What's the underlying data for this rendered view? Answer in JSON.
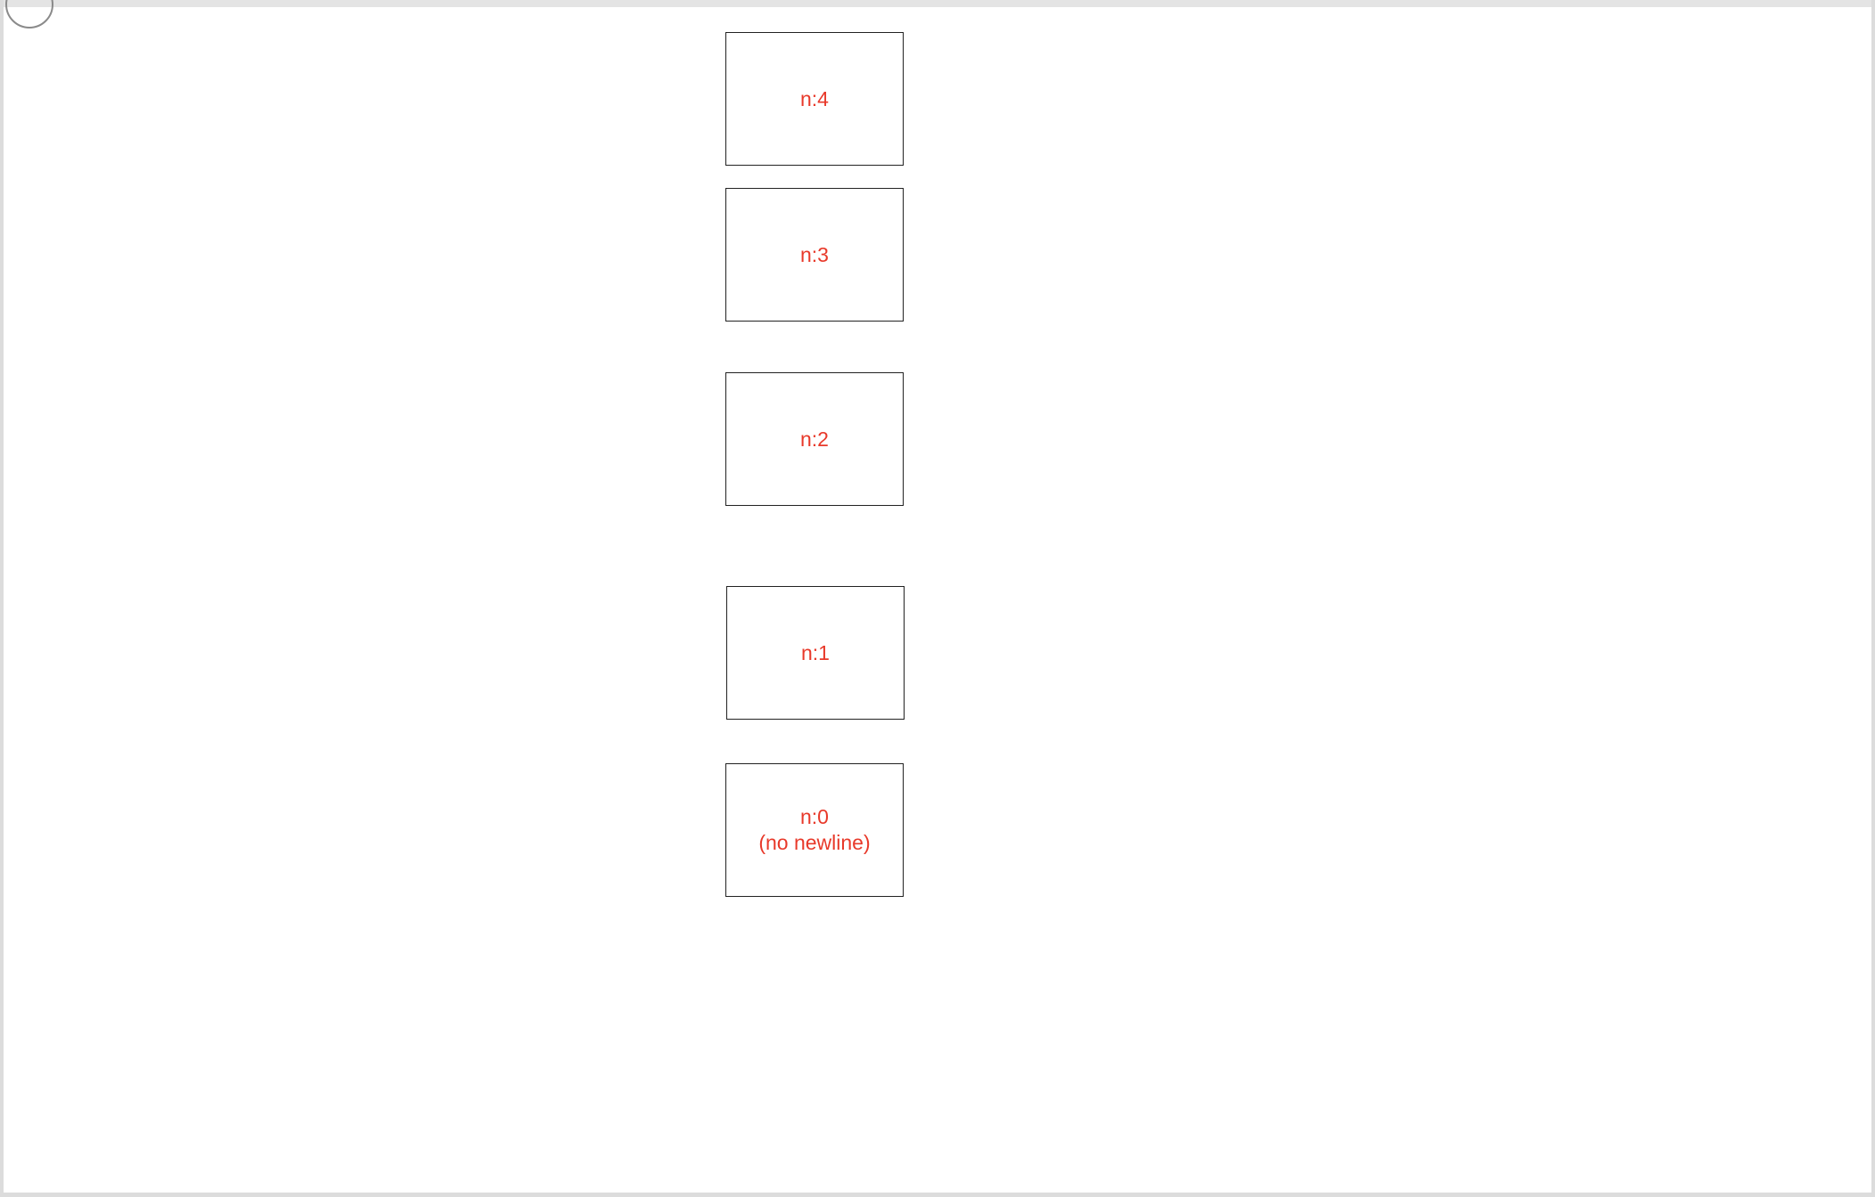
{
  "colors": {
    "label": "#e8392a",
    "box_border": "#222222",
    "background": "#ffffff"
  },
  "nodes": [
    {
      "id": "node-4",
      "line1": "n:4",
      "line2": ""
    },
    {
      "id": "node-3",
      "line1": "n:3",
      "line2": ""
    },
    {
      "id": "node-2",
      "line1": "n:2",
      "line2": ""
    },
    {
      "id": "node-1",
      "line1": "n:1",
      "line2": ""
    },
    {
      "id": "node-0",
      "line1": "n:0",
      "line2": "(no newline)"
    }
  ]
}
